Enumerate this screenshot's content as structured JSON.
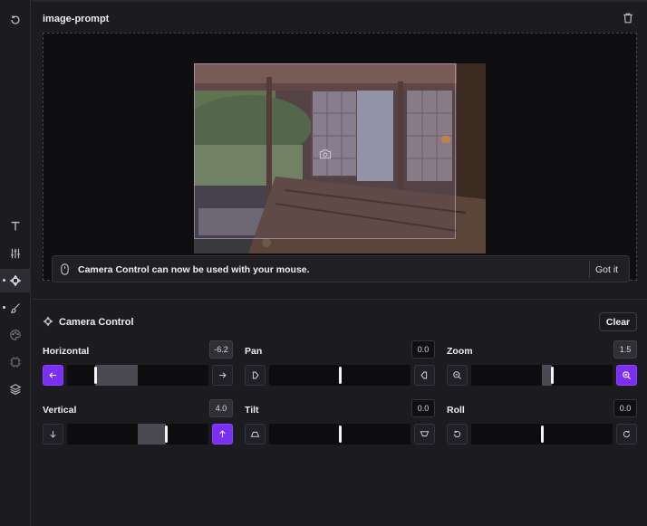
{
  "image_prompt": {
    "title": "image-prompt"
  },
  "toast": {
    "message": "Camera Control can now be used with your mouse.",
    "action": "Got it"
  },
  "camera_control": {
    "title": "Camera Control",
    "clear_label": "Clear",
    "accent_color": "#7b2ff2",
    "controls": [
      {
        "key": "horizontal",
        "label": "Horizontal",
        "value": "-6.2",
        "level": 0.2,
        "fill_from": "left",
        "left_icon": "arrow-left-icon",
        "right_icon": "arrow-right-icon",
        "active_side": "left"
      },
      {
        "key": "pan",
        "label": "Pan",
        "value": "0.0",
        "level": 0.5,
        "fill_from": "none",
        "left_icon": "pan-left-icon",
        "right_icon": "pan-right-icon",
        "active_side": "none"
      },
      {
        "key": "zoom",
        "label": "Zoom",
        "value": "1.5",
        "level": 0.57,
        "fill_from": "center",
        "left_icon": "zoom-out-icon",
        "right_icon": "zoom-in-icon",
        "active_side": "right"
      },
      {
        "key": "vertical",
        "label": "Vertical",
        "value": "4.0",
        "level": 0.7,
        "fill_from": "center",
        "left_icon": "arrow-down-icon",
        "right_icon": "arrow-up-icon",
        "active_side": "right"
      },
      {
        "key": "tilt",
        "label": "Tilt",
        "value": "0.0",
        "level": 0.5,
        "fill_from": "none",
        "left_icon": "tilt-up-icon",
        "right_icon": "tilt-down-icon",
        "active_side": "none"
      },
      {
        "key": "roll",
        "label": "Roll",
        "value": "0.0",
        "level": 0.5,
        "fill_from": "none",
        "left_icon": "rotate-left-icon",
        "right_icon": "rotate-right-icon",
        "active_side": "none"
      }
    ]
  }
}
